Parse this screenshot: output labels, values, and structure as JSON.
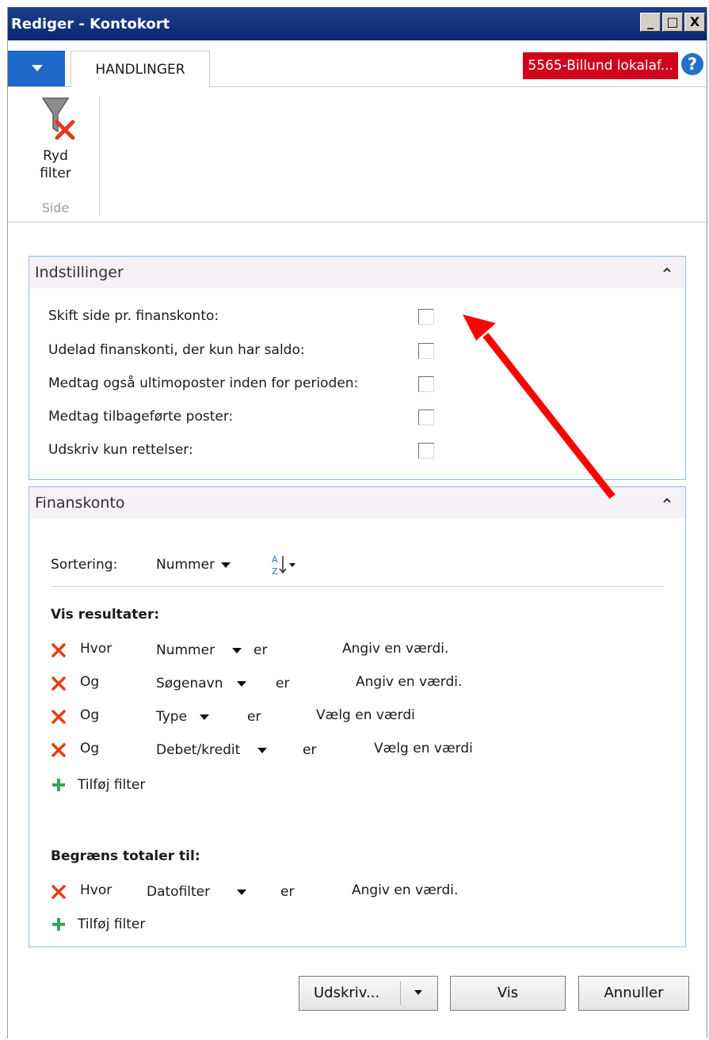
{
  "window": {
    "title": "Rediger - Kontokort",
    "controls": [
      "_",
      "□",
      "X"
    ]
  },
  "tabbar": {
    "menu_icon": "chevron-down-icon",
    "tab_label": "HANDLINGER",
    "company": "5565-Billund lokalaf...",
    "help_icon": "?"
  },
  "ribbon": {
    "clear_filter_label_line1": "Ryd",
    "clear_filter_label_line2": "filter",
    "group_label": "Side"
  },
  "options": {
    "title": "Indstillinger",
    "items": [
      {
        "label": "Skift side pr. finanskonto:",
        "checked": false
      },
      {
        "label": "Udelad finanskonti, der kun har saldo:",
        "checked": false
      },
      {
        "label": "Medtag også ultimoposter inden for perioden:",
        "checked": false
      },
      {
        "label": "Medtag tilbageførte poster:",
        "checked": false
      },
      {
        "label": "Udskriv kun rettelser:",
        "checked": false
      }
    ]
  },
  "account": {
    "title": "Finanskonto",
    "sort_label": "Sortering:",
    "sort_value": "Nummer",
    "sort_order_icon": "sort-ascending-icon",
    "results_heading": "Vis resultater:",
    "filters": [
      {
        "conj": "Hvor",
        "field": "Nummer",
        "op": "er",
        "value": "Angiv en værdi."
      },
      {
        "conj": "Og",
        "field": "Søgenavn",
        "op": "er",
        "value": "Angiv en værdi."
      },
      {
        "conj": "Og",
        "field": "Type",
        "op": "er",
        "value": "Vælg en værdi"
      },
      {
        "conj": "Og",
        "field": "Debet/kredit",
        "op": "er",
        "value": "Vælg en værdi"
      }
    ],
    "add_filter_label": "Tilføj filter",
    "totals_heading": "Begræns totaler til:",
    "totals_filter": {
      "conj": "Hvor",
      "field": "Datofilter",
      "op": "er",
      "value": "Angiv en værdi."
    },
    "totals_add_filter_label": "Tilføj filter"
  },
  "footer": {
    "print_label": "Udskriv...",
    "view_label": "Vis",
    "cancel_label": "Annuller"
  },
  "colors": {
    "titlebar": "#0d2670",
    "accent_blue": "#1d68c8",
    "company_badge": "#d0021b",
    "annotation_arrow": "#ff0000",
    "remove_x": "#e04010",
    "add_plus": "#3aa35a"
  }
}
